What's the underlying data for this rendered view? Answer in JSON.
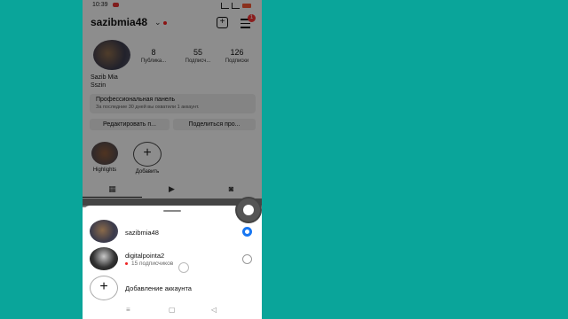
{
  "status_bar": {
    "time": "10:39"
  },
  "profile": {
    "username": "sazibmia48",
    "notification_count": "1",
    "stats": [
      {
        "value": "8",
        "label": "Публика..."
      },
      {
        "value": "55",
        "label": "Подписч..."
      },
      {
        "value": "126",
        "label": "Подписки"
      }
    ],
    "display_name": "Sazib Mia",
    "bio": "Sszin",
    "pro_panel": {
      "title": "Профессиональная панель",
      "subtitle": "За последние 30 дней вы охватили 1 аккаунт."
    },
    "edit_button": "Редактировать п...",
    "share_button": "Поделиться про...",
    "highlights": [
      {
        "label": "Highlights"
      },
      {
        "label": "Добавить"
      }
    ]
  },
  "account_sheet": {
    "accounts": [
      {
        "name": "sazibmia48",
        "selected": true
      },
      {
        "name": "digitalpointa2",
        "subtitle": "15 подписчиков",
        "selected": false
      }
    ],
    "add_account": "Добавление аккаунта"
  },
  "icons": {
    "grid": "grid-icon",
    "reels": "reels-icon",
    "tagged": "tagged-icon",
    "create": "plus-square-icon",
    "menu": "hamburger-icon"
  },
  "colors": {
    "background": "#0aa59a",
    "accent": "#1877f2",
    "badge": "#e33333"
  }
}
